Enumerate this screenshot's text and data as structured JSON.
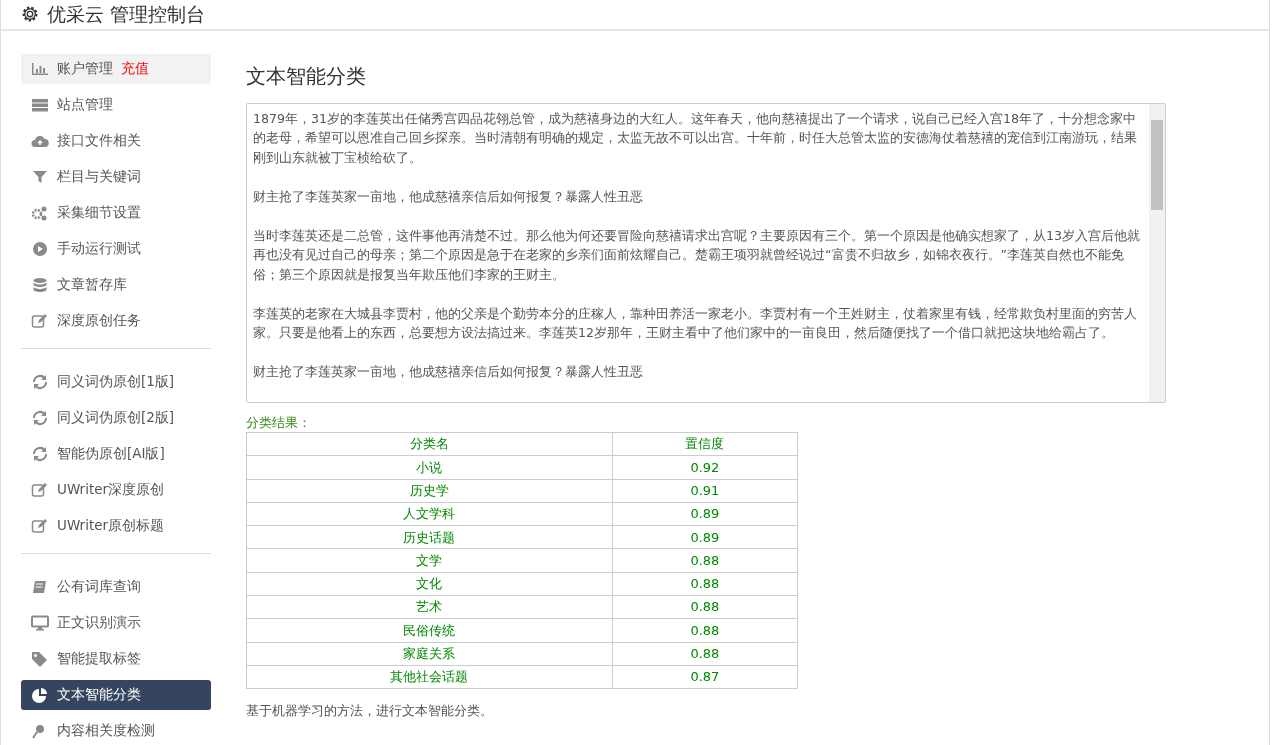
{
  "header": {
    "title": "优采云 管理控制台"
  },
  "sidebar": {
    "groups": [
      {
        "items": [
          {
            "label": "账户管理",
            "tag": "充值",
            "highlighted": true,
            "selected": false
          },
          {
            "label": "站点管理",
            "highlighted": false,
            "selected": false
          },
          {
            "label": "接口文件相关",
            "highlighted": false,
            "selected": false
          },
          {
            "label": "栏目与关键词",
            "highlighted": false,
            "selected": false
          },
          {
            "label": "采集细节设置",
            "highlighted": false,
            "selected": false
          },
          {
            "label": "手动运行测试",
            "highlighted": false,
            "selected": false
          },
          {
            "label": "文章暂存库",
            "highlighted": false,
            "selected": false
          },
          {
            "label": "深度原创任务",
            "highlighted": false,
            "selected": false
          }
        ]
      },
      {
        "items": [
          {
            "label": "同义词伪原创[1版]",
            "highlighted": false,
            "selected": false
          },
          {
            "label": "同义词伪原创[2版]",
            "highlighted": false,
            "selected": false
          },
          {
            "label": "智能伪原创[AI版]",
            "highlighted": false,
            "selected": false
          },
          {
            "label": "UWriter深度原创",
            "highlighted": false,
            "selected": false
          },
          {
            "label": "UWriter原创标题",
            "highlighted": false,
            "selected": false
          }
        ]
      },
      {
        "items": [
          {
            "label": "公有词库查询",
            "highlighted": false,
            "selected": false
          },
          {
            "label": "正文识别演示",
            "highlighted": false,
            "selected": false
          },
          {
            "label": "智能提取标签",
            "highlighted": false,
            "selected": false
          },
          {
            "label": "文本智能分类",
            "highlighted": false,
            "selected": true
          },
          {
            "label": "内容相关度检测",
            "highlighted": false,
            "selected": false
          }
        ]
      }
    ]
  },
  "main": {
    "title": "文本智能分类",
    "input_paragraphs": [
      "1879年，31岁的李莲英出任储秀宫四品花翎总管，成为慈禧身边的大红人。这年春天，他向慈禧提出了一个请求，说自己已经入宫18年了，十分想念家中的老母，希望可以恩准自己回乡探亲。当时清朝有明确的规定，太监无故不可以出宫。十年前，时任大总管太监的安德海仗着慈禧的宠信到江南游玩，结果刚到山东就被丁宝桢给砍了。",
      "财主抢了李莲英家一亩地，他成慈禧亲信后如何报复？暴露人性丑恶",
      "当时李莲英还是二总管，这件事他再清楚不过。那么他为何还要冒险向慈禧请求出宫呢？主要原因有三个。第一个原因是他确实想家了，从13岁入宫后他就再也没有见过自己的母亲；第二个原因是急于在老家的乡亲们面前炫耀自己。楚霸王项羽就曾经说过“富贵不归故乡，如锦衣夜行。”李莲英自然也不能免俗；第三个原因就是报复当年欺压他们李家的王财主。",
      "李莲英的老家在大城县李贾村，他的父亲是个勤劳本分的庄稼人，靠种田养活一家老小。李贾村有一个王姓财主，仗着家里有钱，经常欺负村里面的穷苦人家。只要是他看上的东西，总要想方设法搞过来。李莲英12岁那年，王财主看中了他们家中的一亩良田，然后随便找了一个借口就把这块地给霸占了。",
      "财主抢了李莲英家一亩地，他成慈禧亲信后如何报复？暴露人性丑恶"
    ],
    "result_label": "分类结果：",
    "table": {
      "columns": [
        "分类名",
        "置信度"
      ],
      "rows": [
        [
          "小说",
          "0.92"
        ],
        [
          "历史学",
          "0.91"
        ],
        [
          "人文学科",
          "0.89"
        ],
        [
          "历史话题",
          "0.89"
        ],
        [
          "文学",
          "0.88"
        ],
        [
          "文化",
          "0.88"
        ],
        [
          "艺术",
          "0.88"
        ],
        [
          "民俗传统",
          "0.88"
        ],
        [
          "家庭关系",
          "0.88"
        ],
        [
          "其他社会话题",
          "0.87"
        ]
      ]
    },
    "footnote": "基于机器学习的方法，进行文本智能分类。"
  }
}
